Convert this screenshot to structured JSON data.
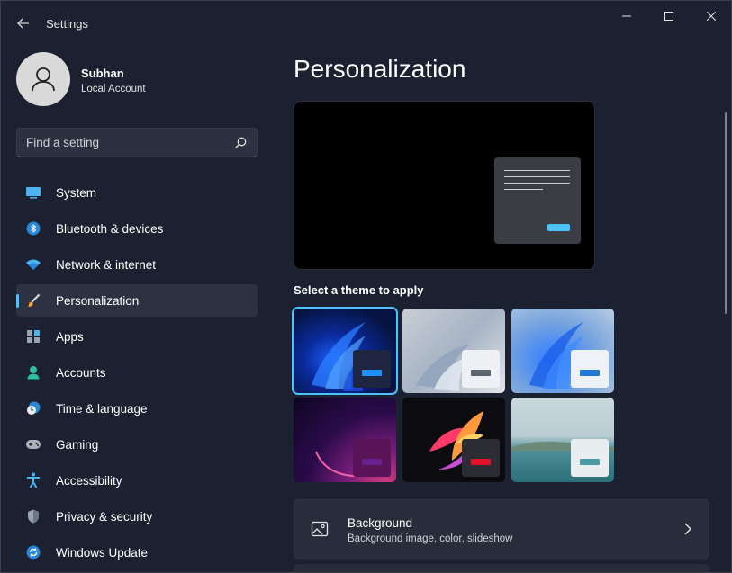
{
  "window": {
    "title": "Settings"
  },
  "profile": {
    "name": "Subhan",
    "account_type": "Local Account"
  },
  "search": {
    "placeholder": "Find a setting"
  },
  "nav": {
    "items": [
      {
        "label": "System",
        "icon": "system-icon"
      },
      {
        "label": "Bluetooth & devices",
        "icon": "bluetooth-icon"
      },
      {
        "label": "Network & internet",
        "icon": "wifi-icon"
      },
      {
        "label": "Personalization",
        "icon": "brush-icon",
        "active": true
      },
      {
        "label": "Apps",
        "icon": "apps-icon"
      },
      {
        "label": "Accounts",
        "icon": "accounts-icon"
      },
      {
        "label": "Time & language",
        "icon": "clock-globe-icon"
      },
      {
        "label": "Gaming",
        "icon": "gamepad-icon"
      },
      {
        "label": "Accessibility",
        "icon": "accessibility-icon"
      },
      {
        "label": "Privacy & security",
        "icon": "shield-icon"
      },
      {
        "label": "Windows Update",
        "icon": "windows-update-icon"
      }
    ]
  },
  "main": {
    "title": "Personalization",
    "themes_label": "Select a theme to apply",
    "themes": [
      {
        "name": "windows-dark",
        "selected": true
      },
      {
        "name": "windows-glow"
      },
      {
        "name": "windows-light"
      },
      {
        "name": "captured-motion"
      },
      {
        "name": "flow"
      },
      {
        "name": "sunrise"
      }
    ],
    "background": {
      "title": "Background",
      "subtitle": "Background image, color, slideshow"
    }
  },
  "colors": {
    "accent": "#4cc2ff",
    "window_bg": "#1b2130",
    "card_bg": "#272d3a",
    "nav_active_bg": "#2c3241"
  }
}
